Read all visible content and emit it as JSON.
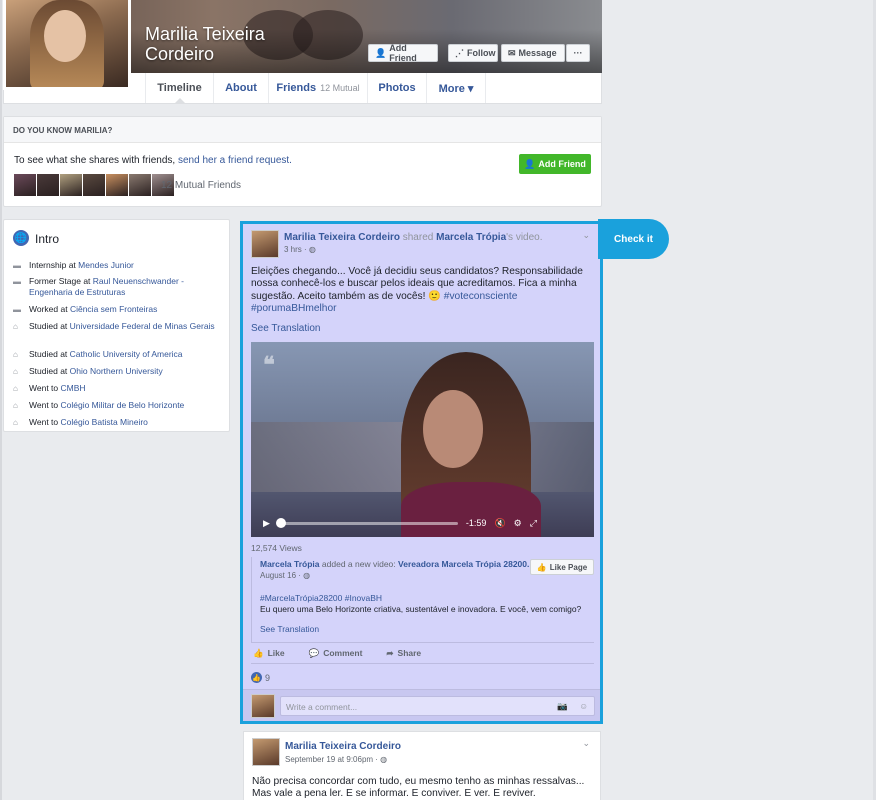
{
  "profile": {
    "name_line1": "Marilia Teixeira",
    "name_line2": "Cordeiro",
    "buttons": {
      "add_friend": "Add Friend",
      "follow": "Follow",
      "message": "Message",
      "more_dots": "···"
    },
    "tabs": [
      {
        "label": "Timeline",
        "sub": ""
      },
      {
        "label": "About",
        "sub": ""
      },
      {
        "label": "Friends",
        "sub": "12 Mutual"
      },
      {
        "label": "Photos",
        "sub": ""
      },
      {
        "label": "More ▾",
        "sub": ""
      }
    ]
  },
  "dyk": {
    "heading": "DO YOU KNOW MARILIA?",
    "text_before": "To see what she shares with friends,",
    "text_link": "send her a friend request.",
    "button": "Add Friend",
    "mutual": "12 Mutual Friends",
    "thumb_colors": [
      "#6b4a5a",
      "#4a3a3a",
      "#b0a080",
      "#5a4a40",
      "#c89060",
      "#8a7a70",
      "#a09090"
    ]
  },
  "intro": {
    "title": "Intro",
    "items": [
      {
        "icon": "briefcase-icon",
        "text": "Internship at ",
        "link": "Mendes Junior"
      },
      {
        "icon": "briefcase-icon",
        "text": "Former Stage at ",
        "link": "Raul Neuenschwander - Engenharia de Estruturas"
      },
      {
        "icon": "briefcase-icon",
        "text": "Worked at ",
        "link": "Ciência sem Fronteiras"
      },
      {
        "icon": "graduation-cap-icon",
        "text": "Studied at ",
        "link": "Universidade Federal de Minas Gerais"
      },
      {
        "icon": "graduation-cap-icon",
        "text": "Studied at ",
        "link": "Catholic University of America"
      },
      {
        "icon": "graduation-cap-icon",
        "text": "Studied at ",
        "link": "Ohio Northern University"
      },
      {
        "icon": "graduation-cap-icon",
        "text": "Went to ",
        "link": "CMBH"
      },
      {
        "icon": "graduation-cap-icon",
        "text": "Went to ",
        "link": "Colégio Militar de Belo Horizonte"
      },
      {
        "icon": "graduation-cap-icon",
        "text": "Went to ",
        "link": "Colégio Batista Mineiro"
      }
    ]
  },
  "post": {
    "author": "Marilia Teixeira Cordeiro",
    "shared": "shared",
    "source": "Marcela Trópia",
    "source_suffix": "'s video.",
    "time": "3 hrs · ",
    "text": "Eleições chegando... Você já decidiu seus candidatos? Responsabilidade nossa conhecê-los e buscar pelos ideais que acreditamos. Fica a minha sugestão. Aceito também as de vocês! 🙂",
    "hashtag1": "#voteconsciente",
    "hashtag2": "#porumaBHmelhor",
    "see_translation": "See Translation",
    "video_time": "-1:59",
    "views": "12,574 Views",
    "shared_box": {
      "page": "Marcela Trópia",
      "added": "added a new video:",
      "video_title": "Vereadora Marcela Trópia 28200.",
      "date": "August 16 · ",
      "like_page": "Like Page",
      "hashtags": "#MarcelaTrópia28200 #InovaBH",
      "text": "Eu quero uma Belo Horizonte criativa, sustentável e inovadora. E você, vem comigo?",
      "see_translation": "See Translation"
    },
    "actions": {
      "like": "Like",
      "comment": "Comment",
      "share": "Share"
    },
    "like_count": "9",
    "comment_placeholder": "Write a comment..."
  },
  "check_it": "Check it",
  "post2": {
    "author": "Marilia Teixeira Cordeiro",
    "time": "September 19 at 9:06pm · ",
    "text": "Não precisa concordar com tudo, eu mesmo tenho as minhas ressalvas... Mas vale a pena ler. E se informar. E conviver. E ver. E reviver."
  }
}
